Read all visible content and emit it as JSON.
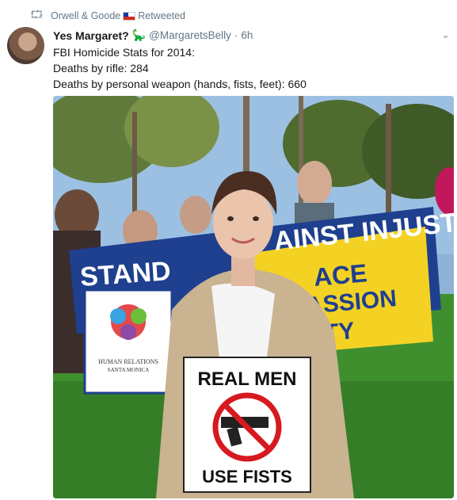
{
  "retweet": {
    "label_pre": "Orwell & Goode",
    "label_post": "Retweeted",
    "icon": "retweet-icon"
  },
  "tweet": {
    "display_name": "Yes Margaret?",
    "name_emoji": "🦕",
    "handle": "@MargaretsBelly",
    "separator": "·",
    "timestamp": "6h",
    "lines": [
      "FBI Homicide Stats for 2014:",
      "Deaths by rifle: 284",
      "Deaths by personal weapon (hands, fists, feet): 660"
    ]
  },
  "photo": {
    "banner_left": "STAND",
    "banner_mid": "AINST INJUST",
    "banner_right_1": "ACE",
    "banner_right_2": "ASSION",
    "banner_right_3": "ITY",
    "org_1": "HUMAN RELATIONS",
    "org_2": "SANTA MONICA",
    "sign_top": "REAL MEN",
    "sign_bottom": "USE FISTS"
  },
  "colors": {
    "banner_blue": "#1f3f8f",
    "banner_yellow": "#f3d224",
    "sign_red": "#d71920",
    "muted": "#657786"
  }
}
